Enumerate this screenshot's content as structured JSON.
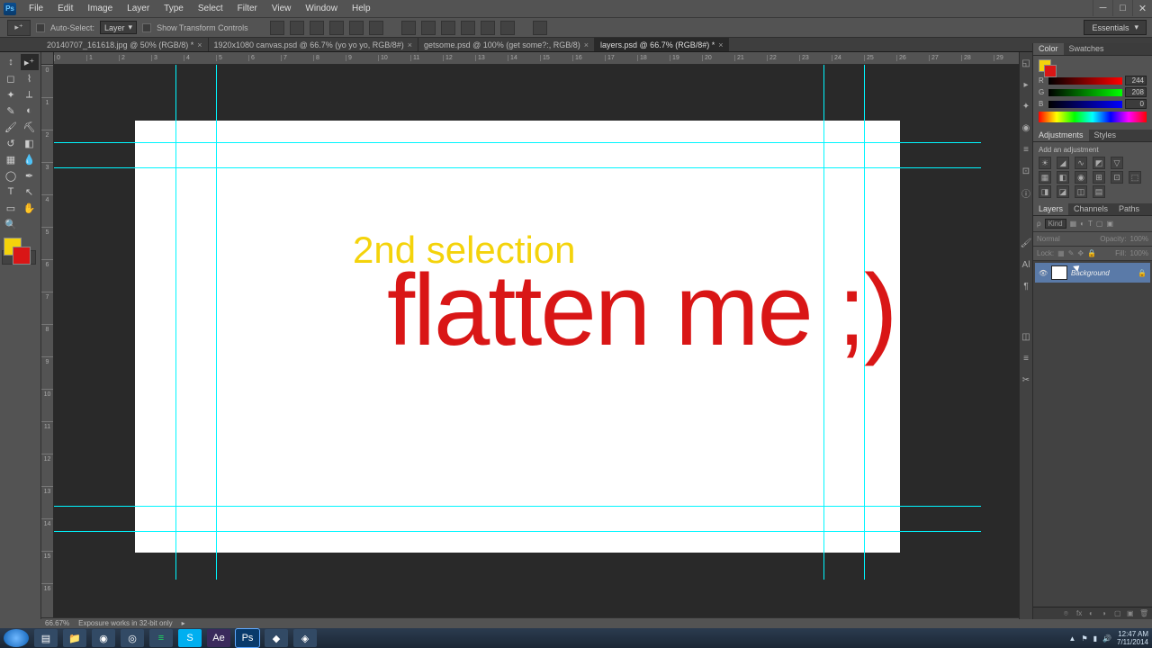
{
  "menu": {
    "items": [
      "File",
      "Edit",
      "Image",
      "Layer",
      "Type",
      "Select",
      "Filter",
      "View",
      "Window",
      "Help"
    ]
  },
  "options": {
    "auto_select": "Auto-Select:",
    "auto_select_mode": "Layer",
    "show_transform": "Show Transform Controls"
  },
  "workspace": "Essentials",
  "tabs": [
    {
      "label": "20140707_161618.jpg @ 50% (RGB/8) *"
    },
    {
      "label": "1920x1080 canvas.psd @ 66.7% (yo yo yo, RGB/8#)"
    },
    {
      "label": "getsome.psd @ 100% (get some?:, RGB/8)"
    },
    {
      "label": "layers.psd @ 66.7% (RGB/8#) *",
      "active": true
    }
  ],
  "ruler_h": [
    "0",
    "1",
    "2",
    "3",
    "4",
    "5",
    "6",
    "7",
    "8",
    "9",
    "10",
    "11",
    "12",
    "13",
    "14",
    "15",
    "16",
    "17",
    "18",
    "19",
    "20",
    "21",
    "22",
    "23",
    "24",
    "25",
    "26",
    "27",
    "28",
    "29"
  ],
  "ruler_v": [
    "0",
    "1",
    "2",
    "3",
    "4",
    "5",
    "6",
    "7",
    "8",
    "9",
    "10",
    "11",
    "12",
    "13",
    "14",
    "15",
    "16"
  ],
  "canvas": {
    "text1": "2nd selection",
    "text2": "flatten me ;)"
  },
  "status": {
    "zoom": "66.67%",
    "info": "Exposure works in 32-bit only"
  },
  "color_panel": {
    "tab1": "Color",
    "tab2": "Swatches",
    "r_label": "R",
    "g_label": "G",
    "b_label": "B",
    "r": "244",
    "g": "208",
    "b": "0"
  },
  "adjustments": {
    "tab1": "Adjustments",
    "tab2": "Styles",
    "title": "Add an adjustment"
  },
  "layers": {
    "tab1": "Layers",
    "tab2": "Channels",
    "tab3": "Paths",
    "kind": "Kind",
    "blend": "Normal",
    "opacity_label": "Opacity:",
    "opacity": "100%",
    "lock_label": "Lock:",
    "fill_label": "Fill:",
    "fill": "100%",
    "layer_name": "Background"
  },
  "taskbar": {
    "time": "12:47 AM",
    "date": "7/11/2014"
  }
}
